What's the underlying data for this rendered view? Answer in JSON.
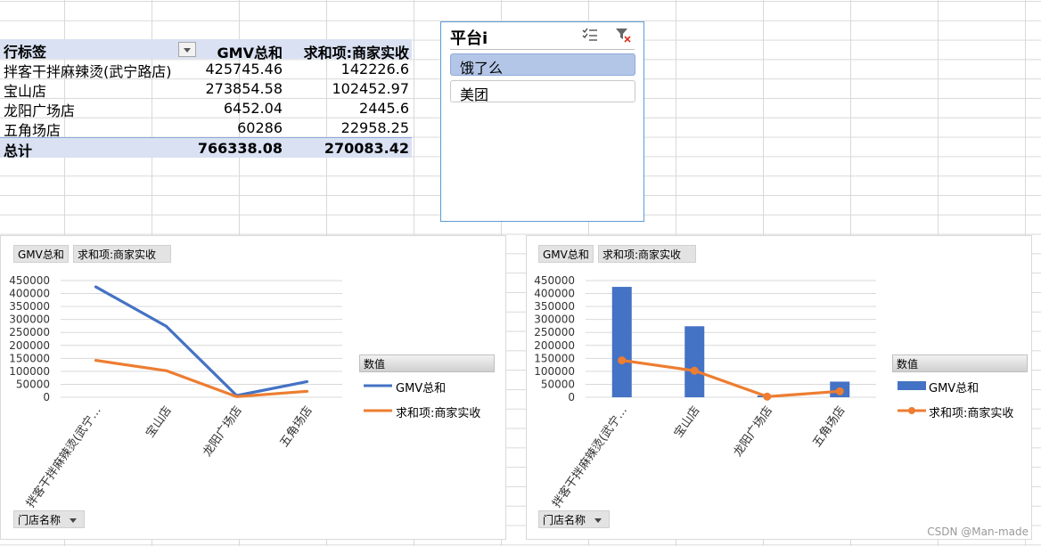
{
  "pivot": {
    "headers": [
      "行标签",
      "GMV总和",
      "求和项:商家实收"
    ],
    "rows": [
      {
        "label": "拌客干拌麻辣烫(武宁路店)",
        "gmv": "425745.46",
        "income": "142226.6"
      },
      {
        "label": "宝山店",
        "gmv": "273854.58",
        "income": "102452.97"
      },
      {
        "label": "龙阳广场店",
        "gmv": "6452.04",
        "income": "2445.6"
      },
      {
        "label": "五角场店",
        "gmv": "60286",
        "income": "22958.25"
      }
    ],
    "total": {
      "label": "总计",
      "gmv": "766338.08",
      "income": "270083.42"
    }
  },
  "slicer": {
    "title": "平台i",
    "items": [
      {
        "label": "饿了么",
        "selected": true
      },
      {
        "label": "美团",
        "selected": false
      }
    ]
  },
  "charts": {
    "field_gmv": "GMV总和",
    "field_income": "求和项:商家实收",
    "axis_field": "门店名称",
    "legend_title": "数值"
  },
  "chart_data": [
    {
      "type": "line",
      "categories": [
        "拌客干拌麻辣烫(武宁…",
        "宝山店",
        "龙阳广场店",
        "五角场店"
      ],
      "series": [
        {
          "name": "GMV总和",
          "values": [
            425745.46,
            273854.58,
            6452.04,
            60286
          ],
          "color": "#4472c4"
        },
        {
          "name": "求和项:商家实收",
          "values": [
            142226.6,
            102452.97,
            2445.6,
            22958.25
          ],
          "color": "#ed7d31"
        }
      ],
      "yticks": [
        "0",
        "50000",
        "100000",
        "150000",
        "200000",
        "250000",
        "300000",
        "350000",
        "400000",
        "450000"
      ],
      "ylim": [
        0,
        450000
      ],
      "legend": "right"
    },
    {
      "type": "bar",
      "categories": [
        "拌客干拌麻辣烫(武宁…",
        "宝山店",
        "龙阳广场店",
        "五角场店"
      ],
      "series": [
        {
          "name": "GMV总和",
          "kind": "bar",
          "values": [
            425745.46,
            273854.58,
            6452.04,
            60286
          ],
          "color": "#4472c4"
        },
        {
          "name": "求和项:商家实收",
          "kind": "line-marker",
          "values": [
            142226.6,
            102452.97,
            2445.6,
            22958.25
          ],
          "color": "#ed7d31"
        }
      ],
      "yticks": [
        "0",
        "50000",
        "100000",
        "150000",
        "200000",
        "250000",
        "300000",
        "350000",
        "400000",
        "450000"
      ],
      "ylim": [
        0,
        450000
      ],
      "legend": "right"
    }
  ],
  "watermark": "CSDN @Man-made"
}
